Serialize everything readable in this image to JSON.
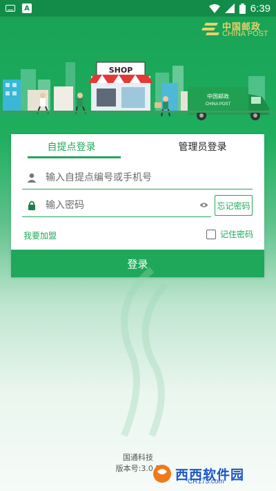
{
  "status_bar": {
    "time": "6:39"
  },
  "brand": {
    "name_cn": "中国邮政",
    "name_en": "CHINA POST"
  },
  "illustration": {
    "shop_sign": "SHOP",
    "truck_label_cn": "中国邮政",
    "truck_label_en": "CHINA POST"
  },
  "login": {
    "tabs": [
      {
        "label": "自提点登录",
        "active": true
      },
      {
        "label": "管理员登录",
        "active": false
      }
    ],
    "account": {
      "placeholder": "输入自提点编号或手机号",
      "value": ""
    },
    "password": {
      "placeholder": "输入密码",
      "value": ""
    },
    "forgot_label": "忘记密码",
    "join_label": "我要加盟",
    "remember": {
      "label": "记住密码",
      "checked": false
    },
    "submit_label": "登录"
  },
  "footer": {
    "company": "国通科技",
    "version_label": "版本号:3.0.5"
  },
  "watermark": {
    "text": "西西软件园",
    "sub": "CR173.com"
  },
  "colors": {
    "primary": "#1fa85a",
    "status_bar": "#138c49",
    "logo_gold": "#e9d36a",
    "watermark_blue": "#1d55c9"
  }
}
